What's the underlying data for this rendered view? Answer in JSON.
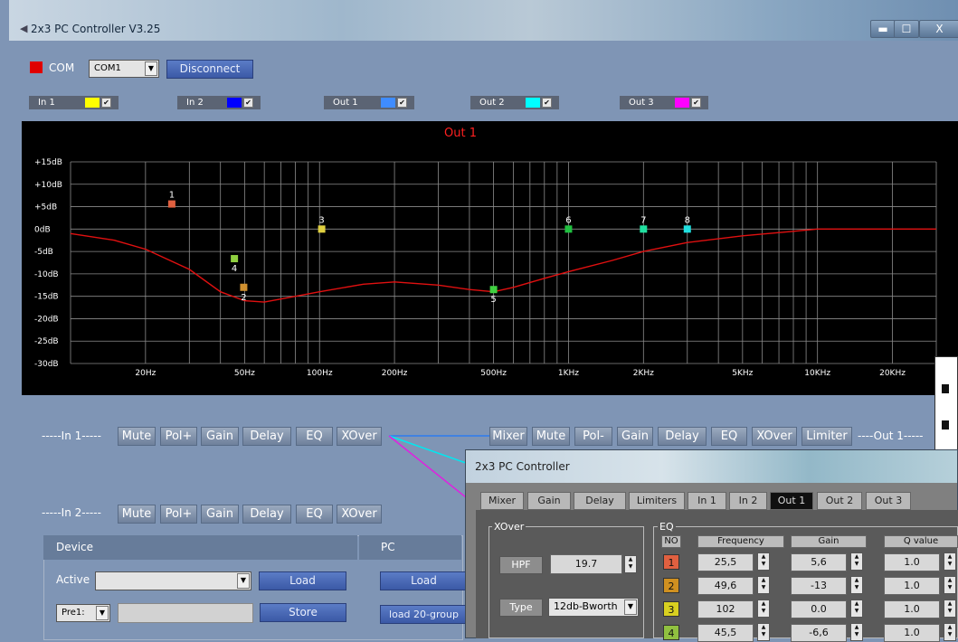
{
  "window": {
    "title": "2x3 PC Controller V3.25",
    "min": "▬",
    "max": "☐",
    "close": "X"
  },
  "com": {
    "label": "COM",
    "port": "COM1",
    "disconnect": "Disconnect",
    "status_color": "#e00000"
  },
  "channels": [
    {
      "label": "In 1",
      "color": "#ffff00",
      "checked": "✔"
    },
    {
      "label": "In 2",
      "color": "#0000ff",
      "checked": "✔"
    },
    {
      "label": "Out 1",
      "color": "#3f8cff",
      "checked": "✔"
    },
    {
      "label": "Out 2",
      "color": "#00ffff",
      "checked": "✔"
    },
    {
      "label": "Out 3",
      "color": "#ff00ff",
      "checked": "✔"
    }
  ],
  "chart_data": {
    "type": "line",
    "title": "Out 1",
    "x_scale": "log",
    "xlim": [
      10,
      30000
    ],
    "ylim": [
      -30,
      15
    ],
    "x_ticks": [
      {
        "v": 20,
        "label": "20Hz"
      },
      {
        "v": 50,
        "label": "50Hz"
      },
      {
        "v": 100,
        "label": "100Hz"
      },
      {
        "v": 200,
        "label": "200Hz"
      },
      {
        "v": 500,
        "label": "500Hz"
      },
      {
        "v": 1000,
        "label": "1KHz"
      },
      {
        "v": 2000,
        "label": "2KHz"
      },
      {
        "v": 5000,
        "label": "5KHz"
      },
      {
        "v": 10000,
        "label": "10KHz"
      },
      {
        "v": 20000,
        "label": "20KHz"
      }
    ],
    "y_ticks": [
      {
        "v": 15,
        "label": "+15dB"
      },
      {
        "v": 10,
        "label": "+10dB"
      },
      {
        "v": 5,
        "label": "+5dB"
      },
      {
        "v": 0,
        "label": "0dB"
      },
      {
        "v": -5,
        "label": "-5dB"
      },
      {
        "v": -10,
        "label": "-10dB"
      },
      {
        "v": -15,
        "label": "-15dB"
      },
      {
        "v": -20,
        "label": "-20dB"
      },
      {
        "v": -25,
        "label": "-25dB"
      },
      {
        "v": -30,
        "label": "-30dB"
      }
    ],
    "grid": true,
    "curve": {
      "color": "#e01010",
      "points": [
        [
          10,
          -1
        ],
        [
          15,
          -2.5
        ],
        [
          20,
          -4.5
        ],
        [
          30,
          -9
        ],
        [
          40,
          -14
        ],
        [
          50,
          -16
        ],
        [
          60,
          -16.3
        ],
        [
          80,
          -15
        ],
        [
          100,
          -14
        ],
        [
          150,
          -12.3
        ],
        [
          200,
          -11.8
        ],
        [
          300,
          -12.5
        ],
        [
          400,
          -13.5
        ],
        [
          500,
          -14
        ],
        [
          600,
          -13
        ],
        [
          800,
          -11
        ],
        [
          1000,
          -9.5
        ],
        [
          1500,
          -7
        ],
        [
          2000,
          -5
        ],
        [
          3000,
          -3
        ],
        [
          5000,
          -1.5
        ],
        [
          8000,
          -0.5
        ],
        [
          10000,
          0
        ],
        [
          20000,
          0
        ],
        [
          30000,
          0
        ]
      ]
    },
    "eq_points": [
      {
        "label": "1",
        "freq": 25.5,
        "gain": 5.6,
        "color": "#e06040"
      },
      {
        "label": "2",
        "freq": 49.6,
        "gain": -13,
        "color": "#d09030"
      },
      {
        "label": "3",
        "freq": 102,
        "gain": 0,
        "color": "#e0d040"
      },
      {
        "label": "4",
        "freq": 45.5,
        "gain": -6.6,
        "color": "#90d040"
      },
      {
        "label": "5",
        "freq": 500,
        "gain": -13.5,
        "color": "#40d040"
      },
      {
        "label": "6",
        "freq": 1000,
        "gain": 0,
        "color": "#20c040"
      },
      {
        "label": "7",
        "freq": 2000,
        "gain": 0,
        "color": "#20e0a0"
      },
      {
        "label": "8",
        "freq": 3000,
        "gain": 0,
        "color": "#20e0e0"
      }
    ]
  },
  "in1_row": {
    "label": "-----In 1-----",
    "buttons": [
      "Mute",
      "Pol+",
      "Gain",
      "Delay",
      "EQ",
      "XOver"
    ]
  },
  "in2_row": {
    "label": "-----In 2-----",
    "buttons": [
      "Mute",
      "Pol+",
      "Gain",
      "Delay",
      "EQ",
      "XOver"
    ]
  },
  "out1_row": {
    "label": "----Out 1-----",
    "buttons": [
      "Mixer",
      "Mute",
      "Pol-",
      "Gain",
      "Delay",
      "EQ",
      "XOver",
      "Limiter"
    ]
  },
  "device": {
    "header": "Device",
    "active": "Active",
    "load": "Load",
    "store": "Store",
    "preset": "Pre1:",
    "pc_header": "PC",
    "pc_load": "Load",
    "pc_load20": "load 20-group"
  },
  "dialog": {
    "title": "2x3 PC Controller",
    "tabs": [
      "Mixer",
      "Gain",
      "Delay",
      "Limiters",
      "In 1",
      "In 2",
      "Out 1",
      "Out 2",
      "Out 3"
    ],
    "active_tab": "Out 1",
    "xover": {
      "label": "XOver",
      "hpf_label": "HPF",
      "hpf_value": "19.7",
      "type_label": "Type",
      "type_value": "12db-Bworth"
    },
    "eq": {
      "label": "EQ",
      "headers": [
        "NO",
        "Frequency",
        "Gain",
        "Q value"
      ],
      "rows": [
        {
          "no": "1",
          "freq": "25,5",
          "gain": "5,6",
          "q": "1.0",
          "color": "#e06040"
        },
        {
          "no": "2",
          "freq": "49,6",
          "gain": "-13",
          "q": "1.0",
          "color": "#d09020"
        },
        {
          "no": "3",
          "freq": "102",
          "gain": "0.0",
          "q": "1.0",
          "color": "#d8d020"
        },
        {
          "no": "4",
          "freq": "45,5",
          "gain": "-6,6",
          "q": "1.0",
          "color": "#90c040"
        }
      ]
    }
  }
}
